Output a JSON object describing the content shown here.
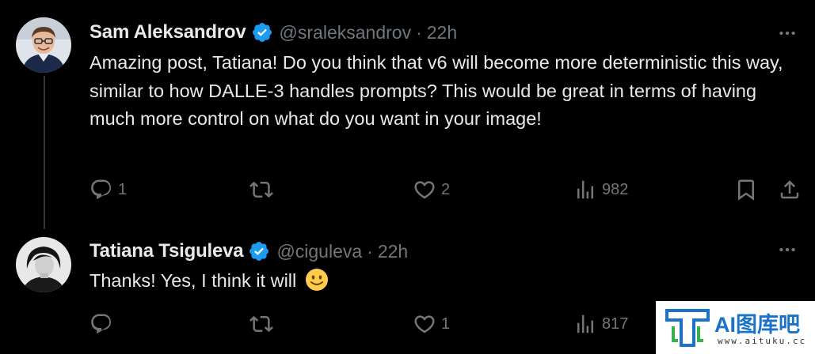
{
  "colors": {
    "background": "#000000",
    "primary_text": "#e7e9ea",
    "secondary_text": "#71767b",
    "verified_badge": "#1d9bf0",
    "thread_line": "#333639"
  },
  "tweets": [
    {
      "author_name": "Sam Aleksandrov",
      "handle": "@sraleksandrov",
      "separator": "·",
      "time": "22h",
      "verified": true,
      "text": "Amazing post, Tatiana! Do you think that v6 will become more deterministic this way, similar to how DALLE-3 handles prompts? This would be great in terms of having much more control on what do you want in your image!",
      "replies": "1",
      "retweets": "",
      "likes": "2",
      "views": "982"
    },
    {
      "author_name": "Tatiana Tsiguleva",
      "handle": "@ciguleva",
      "separator": "·",
      "time": "22h",
      "verified": true,
      "text": "Thanks! Yes, I think it will",
      "emoji": "slightly-smiling-face",
      "replies": "",
      "retweets": "",
      "likes": "1",
      "views": "817"
    }
  ],
  "watermark": {
    "title": "AI图库吧",
    "url": "www.aituku.cc"
  }
}
